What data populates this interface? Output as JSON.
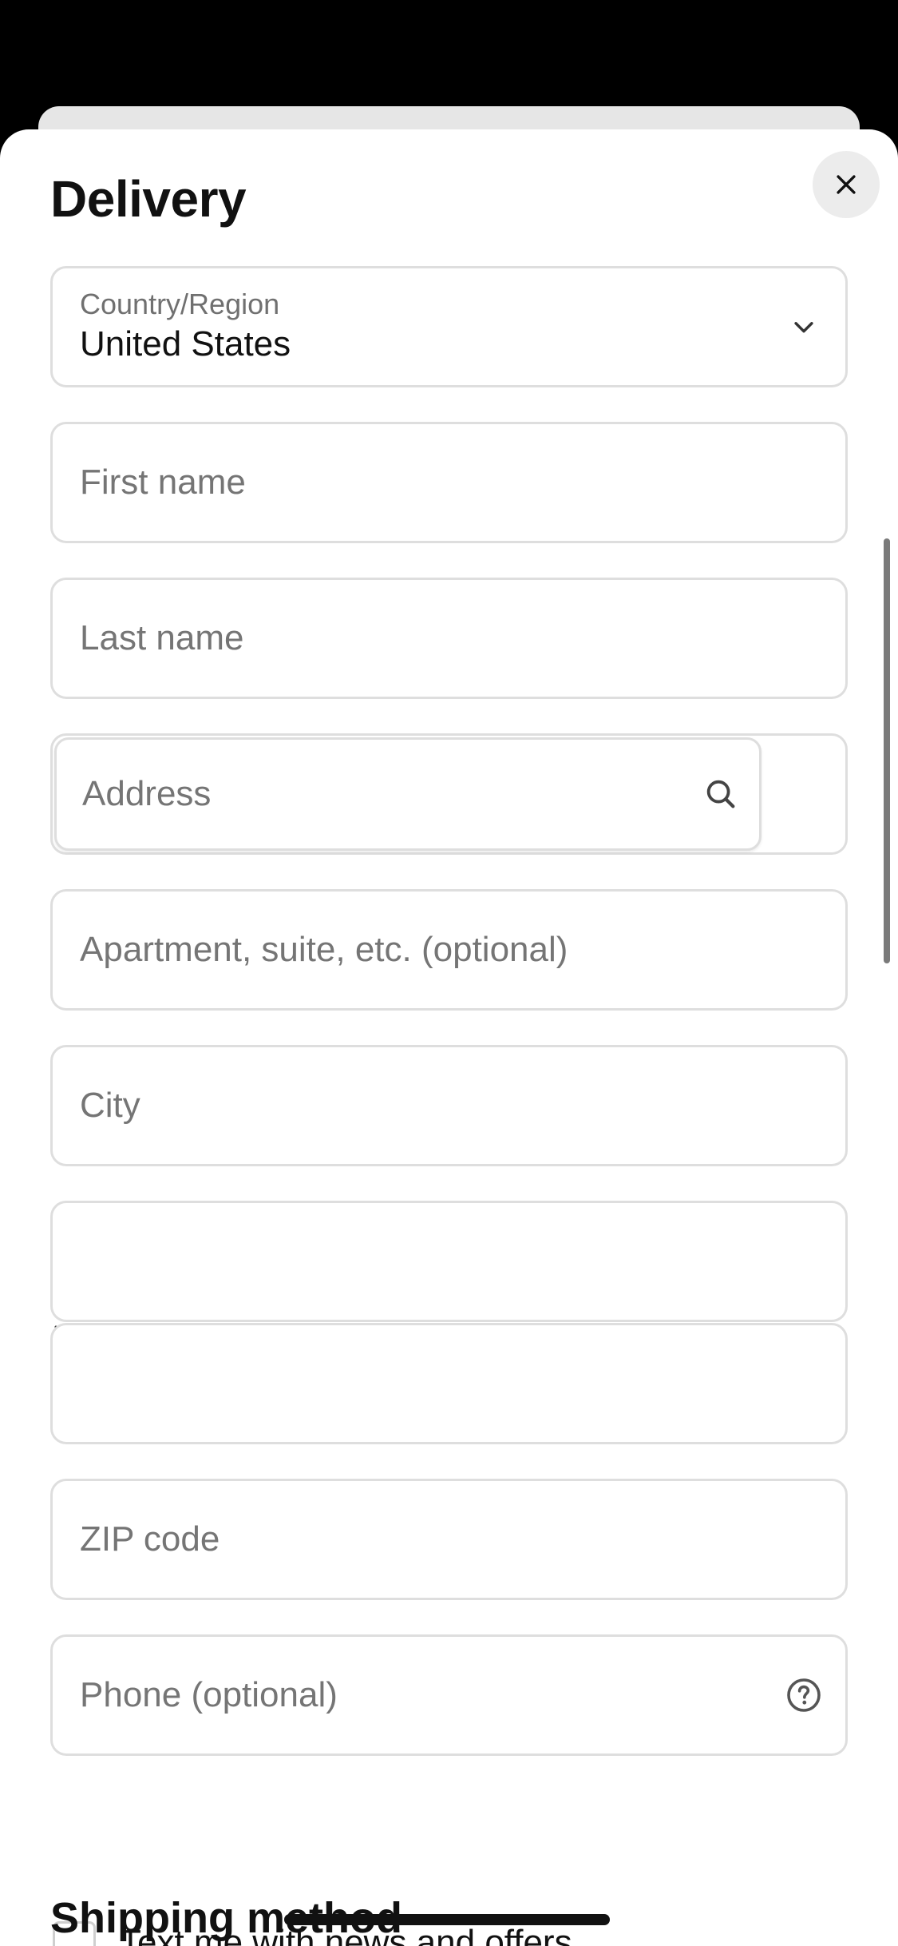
{
  "sheet": {
    "title": "Delivery"
  },
  "form": {
    "country": {
      "label": "Country/Region",
      "value": "United States"
    },
    "first_name": {
      "placeholder": "First name",
      "value": ""
    },
    "last_name": {
      "placeholder": "Last name",
      "value": ""
    },
    "address": {
      "placeholder": "Address",
      "value": ""
    },
    "apartment": {
      "placeholder": "Apartment, suite, etc. (optional)",
      "value": ""
    },
    "city": {
      "placeholder": "City",
      "value": ""
    },
    "state": {
      "value": ""
    },
    "zip": {
      "placeholder": "ZIP code",
      "value": ""
    },
    "phone": {
      "placeholder": "Phone (optional)",
      "value": ""
    },
    "marketing_opt_in": {
      "label": "Text me with news and offers",
      "checked": false
    }
  },
  "shipping": {
    "title": "Shipping method"
  },
  "icons": {
    "close": "close-icon",
    "country_dropdown": "chevron-down-icon",
    "address_search": "search-icon",
    "state_dropdown": "chevron-down-icon",
    "phone_help": "help-circle-icon"
  }
}
